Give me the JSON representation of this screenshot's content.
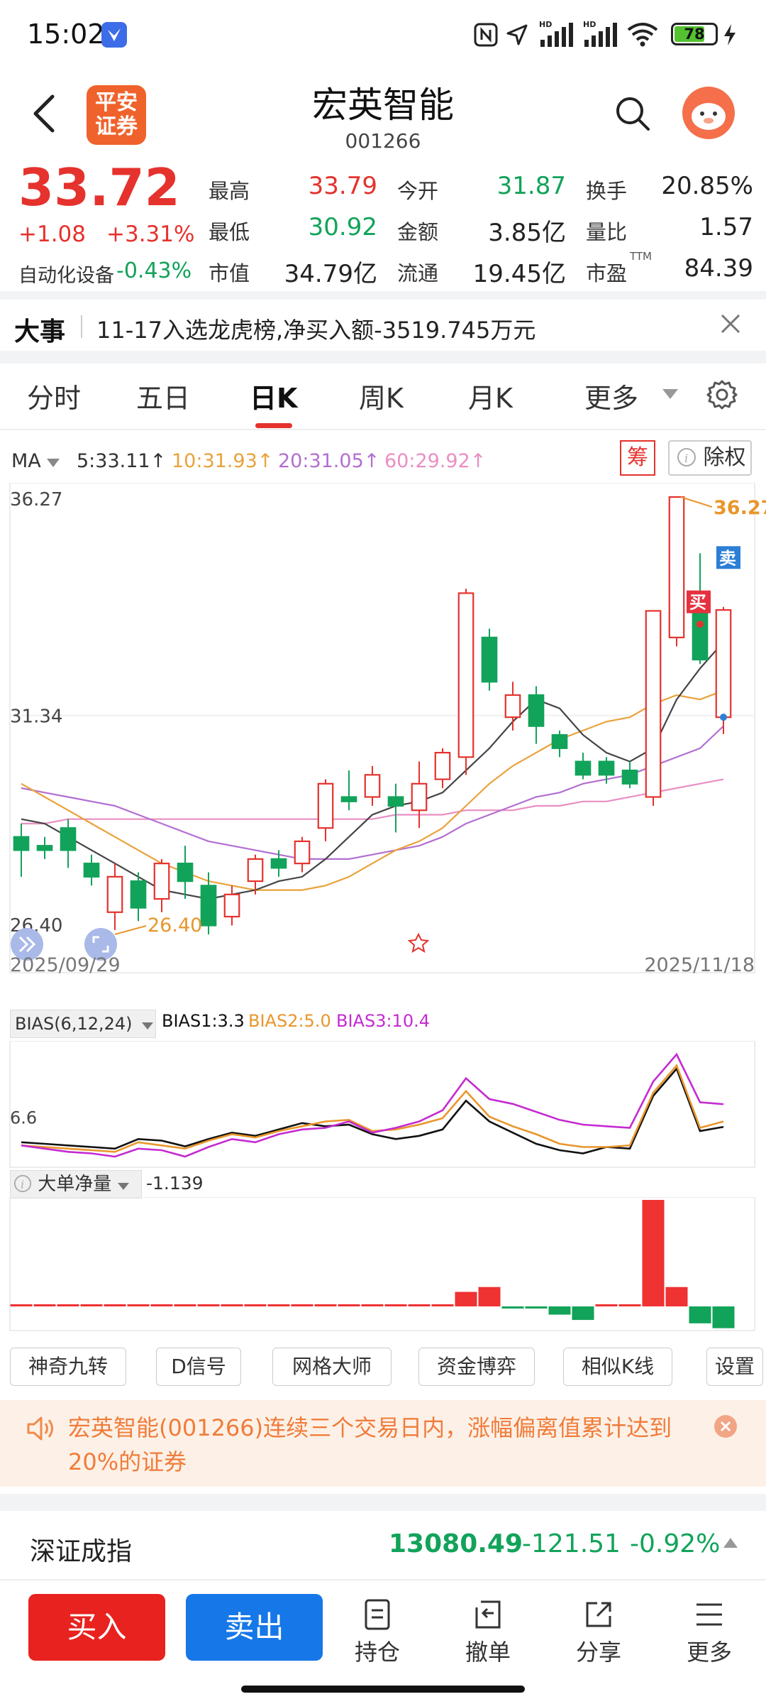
{
  "status_bar": {
    "time": "15:02",
    "battery": "78"
  },
  "header": {
    "title": "宏英智能",
    "code": "001266",
    "logo_text": [
      "平安",
      "证券"
    ]
  },
  "quote": {
    "price": "33.72",
    "change": "+1.08",
    "change_pct": "+3.31%",
    "sector_label": "自动化设备",
    "sector_change": "-0.43%",
    "rows": [
      [
        {
          "label": "最高",
          "value": "33.79",
          "color": "red"
        },
        {
          "label": "今开",
          "value": "31.87",
          "color": "green"
        },
        {
          "label": "换手",
          "value": "20.85%",
          "color": "dark"
        }
      ],
      [
        {
          "label": "最低",
          "value": "30.92",
          "color": "green"
        },
        {
          "label": "金额",
          "value": "3.85亿",
          "color": "dark"
        },
        {
          "label": "量比",
          "value": "1.57",
          "color": "dark"
        }
      ],
      [
        {
          "label": "市值",
          "value": "34.79亿",
          "color": "dark"
        },
        {
          "label": "流通",
          "value": "19.45亿",
          "color": "dark"
        },
        {
          "label": "市盈",
          "value": "84.39",
          "color": "dark",
          "sup": "TTM"
        }
      ]
    ]
  },
  "event": {
    "label": "大事",
    "text": "11-17入选龙虎榜,净买入额-3519.745万元"
  },
  "tabs": [
    "分时",
    "五日",
    "日K",
    "周K",
    "月K",
    "更多"
  ],
  "active_tab": "日K",
  "ma_bar": {
    "label": "MA",
    "items": [
      {
        "text": "5:33.11",
        "color": "#333333"
      },
      {
        "text": "10:31.93",
        "color": "#e9a23b"
      },
      {
        "text": "20:31.05",
        "color": "#b36fd1"
      },
      {
        "text": "60:29.92",
        "color": "#e98fc3"
      }
    ],
    "chou": "筹",
    "chuquan": "除权"
  },
  "chart_data": {
    "type": "candlestick",
    "y_axis_labels": [
      "36.27",
      "31.34",
      "26.40"
    ],
    "ylim": [
      26.4,
      36.27
    ],
    "x_range": [
      "2025/09/29",
      "2025/11/18"
    ],
    "high_marker": "36.27",
    "low_marker": "26.40",
    "buy_marker": "买",
    "sell_marker": "卖",
    "candles": [
      {
        "o": 28.6,
        "c": 28.3,
        "h": 28.9,
        "l": 27.7
      },
      {
        "o": 28.4,
        "c": 28.3,
        "h": 28.6,
        "l": 28.1
      },
      {
        "o": 28.8,
        "c": 28.3,
        "h": 29.0,
        "l": 27.9
      },
      {
        "o": 28.0,
        "c": 27.7,
        "h": 28.2,
        "l": 27.5
      },
      {
        "o": 26.9,
        "c": 27.7,
        "h": 28.0,
        "l": 26.5
      },
      {
        "o": 27.6,
        "c": 27.0,
        "h": 27.8,
        "l": 26.7
      },
      {
        "o": 27.2,
        "c": 28.0,
        "h": 28.1,
        "l": 26.9
      },
      {
        "o": 28.0,
        "c": 27.6,
        "h": 28.4,
        "l": 27.2
      },
      {
        "o": 27.5,
        "c": 26.6,
        "h": 27.8,
        "l": 26.4
      },
      {
        "o": 26.8,
        "c": 27.3,
        "h": 27.5,
        "l": 26.6
      },
      {
        "o": 27.6,
        "c": 28.1,
        "h": 28.2,
        "l": 27.3
      },
      {
        "o": 28.1,
        "c": 27.9,
        "h": 28.3,
        "l": 27.7
      },
      {
        "o": 28.0,
        "c": 28.5,
        "h": 28.6,
        "l": 27.8
      },
      {
        "o": 28.8,
        "c": 29.8,
        "h": 29.9,
        "l": 28.5
      },
      {
        "o": 29.5,
        "c": 29.4,
        "h": 30.1,
        "l": 29.2
      },
      {
        "o": 29.5,
        "c": 30.0,
        "h": 30.2,
        "l": 29.3
      },
      {
        "o": 29.5,
        "c": 29.3,
        "h": 29.8,
        "l": 28.7
      },
      {
        "o": 29.2,
        "c": 29.8,
        "h": 30.3,
        "l": 28.8
      },
      {
        "o": 29.9,
        "c": 30.5,
        "h": 30.6,
        "l": 29.7
      },
      {
        "o": 30.4,
        "c": 34.1,
        "h": 34.2,
        "l": 30.0
      },
      {
        "o": 33.1,
        "c": 32.1,
        "h": 33.3,
        "l": 31.9
      },
      {
        "o": 31.3,
        "c": 31.8,
        "h": 32.1,
        "l": 31.0
      },
      {
        "o": 31.8,
        "c": 31.1,
        "h": 32.0,
        "l": 30.7
      },
      {
        "o": 30.9,
        "c": 30.6,
        "h": 31.0,
        "l": 30.4
      },
      {
        "o": 30.3,
        "c": 30.0,
        "h": 30.5,
        "l": 29.9
      },
      {
        "o": 30.3,
        "c": 30.0,
        "h": 30.4,
        "l": 29.8
      },
      {
        "o": 30.1,
        "c": 29.8,
        "h": 30.3,
        "l": 29.7
      },
      {
        "o": 29.5,
        "c": 33.7,
        "h": 33.7,
        "l": 29.3
      },
      {
        "o": 33.1,
        "c": 36.27,
        "h": 36.27,
        "l": 32.9
      },
      {
        "o": 33.9,
        "c": 32.6,
        "h": 35.0,
        "l": 32.5
      },
      {
        "o": 31.3,
        "c": 33.72,
        "h": 33.79,
        "l": 30.92
      }
    ],
    "ma5": [
      29.0,
      28.9,
      28.6,
      28.3,
      28.0,
      27.7,
      27.4,
      27.3,
      27.2,
      27.3,
      27.4,
      27.6,
      27.7,
      28.1,
      28.6,
      29.1,
      29.3,
      29.4,
      29.6,
      30.1,
      30.6,
      31.2,
      31.7,
      31.5,
      30.9,
      30.5,
      30.3,
      30.6,
      31.7,
      32.4,
      33.0
    ],
    "ma10": [
      29.8,
      29.5,
      29.2,
      28.9,
      28.6,
      28.3,
      28.0,
      27.8,
      27.6,
      27.5,
      27.4,
      27.4,
      27.4,
      27.5,
      27.7,
      28.0,
      28.3,
      28.5,
      28.8,
      29.3,
      29.8,
      30.2,
      30.5,
      30.8,
      31.0,
      31.2,
      31.3,
      31.6,
      31.8,
      31.7,
      31.9
    ],
    "ma20": [
      29.7,
      29.6,
      29.5,
      29.4,
      29.3,
      29.1,
      28.9,
      28.7,
      28.5,
      28.4,
      28.3,
      28.2,
      28.1,
      28.1,
      28.1,
      28.2,
      28.3,
      28.4,
      28.6,
      28.9,
      29.1,
      29.3,
      29.5,
      29.6,
      29.8,
      29.9,
      30.0,
      30.2,
      30.4,
      30.6,
      31.1
    ],
    "ma60": [
      28.9,
      28.9,
      29.0,
      29.0,
      29.0,
      29.0,
      29.0,
      29.0,
      29.0,
      29.0,
      29.0,
      29.0,
      29.0,
      29.0,
      29.0,
      29.0,
      29.1,
      29.1,
      29.1,
      29.2,
      29.2,
      29.2,
      29.3,
      29.3,
      29.4,
      29.4,
      29.5,
      29.6,
      29.7,
      29.8,
      29.9
    ]
  },
  "bias_panel": {
    "selector": "BIAS(6,12,24)",
    "items": [
      {
        "text": "BIAS1:3.3",
        "color": "#111111"
      },
      {
        "text": "BIAS2:5.0",
        "color": "#e9962b"
      },
      {
        "text": "BIAS3:10.4",
        "color": "#c42bd1"
      }
    ],
    "y_label": "6.6",
    "chart_data": {
      "type": "line",
      "series": [
        {
          "name": "BIAS1",
          "values": [
            -1.5,
            -2.0,
            -2.5,
            -3.0,
            -3.5,
            -0.5,
            -1.0,
            -2.8,
            -0.5,
            1.5,
            0.5,
            2.5,
            4.5,
            3.5,
            4.0,
            1.0,
            -0.5,
            0.5,
            2.5,
            11.5,
            5.0,
            1.5,
            -2.0,
            -4.0,
            -5.0,
            -3.0,
            -3.5,
            13.0,
            21.5,
            2.0,
            3.3
          ]
        },
        {
          "name": "BIAS2",
          "values": [
            -2.5,
            -3.0,
            -3.5,
            -4.0,
            -4.5,
            -1.5,
            -2.5,
            -3.5,
            -1.0,
            1.0,
            0.0,
            2.0,
            3.5,
            5.0,
            5.5,
            2.0,
            2.5,
            4.0,
            6.0,
            14.5,
            6.5,
            3.5,
            1.0,
            -2.0,
            -3.0,
            -3.0,
            -2.5,
            14.0,
            22.5,
            3.0,
            5.0
          ]
        },
        {
          "name": "BIAS3",
          "values": [
            -2.5,
            -3.5,
            -4.5,
            -5.0,
            -6.0,
            -3.5,
            -4.0,
            -6.0,
            -3.0,
            -0.5,
            -1.5,
            1.0,
            2.5,
            3.0,
            5.0,
            1.5,
            3.0,
            5.0,
            8.5,
            18.5,
            12.0,
            10.5,
            8.0,
            5.5,
            4.0,
            3.5,
            3.0,
            17.5,
            26.0,
            11.0,
            10.4
          ]
        }
      ]
    }
  },
  "big_order_panel": {
    "label": "大单净量",
    "value": "-1.139",
    "chart_data": {
      "type": "bar",
      "values": [
        0.04,
        0.02,
        0,
        0,
        0,
        0,
        0,
        0.02,
        0.01,
        0.01,
        0.01,
        0,
        0,
        0.01,
        0.01,
        0.01,
        0.02,
        0.03,
        0.03,
        0.3,
        0.4,
        -0.04,
        -0.04,
        -0.17,
        -0.28,
        0.01,
        0.01,
        2.2,
        0.4,
        -0.35,
        -0.45
      ]
    }
  },
  "tool_buttons": [
    "神奇九转",
    "D信号",
    "网格大师",
    "资金博弈",
    "相似K线",
    "设置"
  ],
  "notice": {
    "line1": "宏英智能(001266)连续三个交易日内，涨幅偏离值累计达到",
    "line2": "20%的证券"
  },
  "index": {
    "name": "深证成指",
    "value": "13080.49",
    "change": "-121.51",
    "change_pct": "-0.92%"
  },
  "bottom_bar": {
    "buy": "买入",
    "sell": "卖出",
    "items": [
      "持仓",
      "撤单",
      "分享",
      "更多"
    ],
    "colors": {
      "buy": "#e8221e",
      "sell": "#1677e8"
    }
  }
}
